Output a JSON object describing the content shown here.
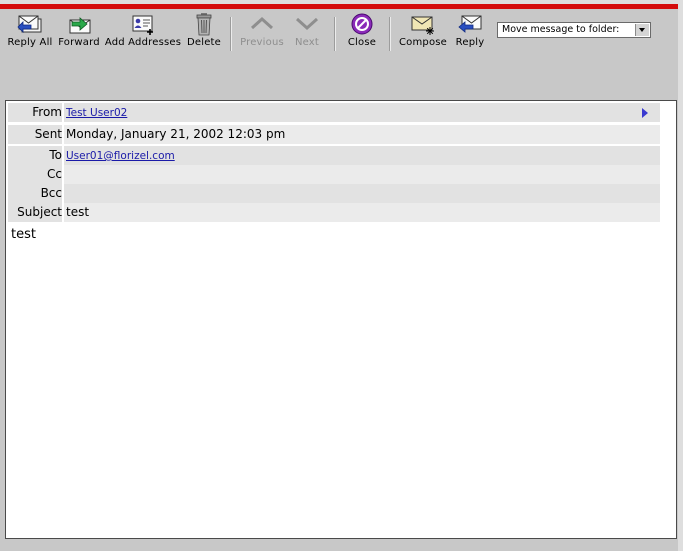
{
  "toolbar": {
    "reply_all": "Reply All",
    "forward": "Forward",
    "add_addresses": "Add Addresses",
    "delete": "Delete",
    "previous": "Previous",
    "next": "Next",
    "close": "Close",
    "compose": "Compose",
    "reply": "Reply",
    "move_folder": "Move message to folder:"
  },
  "message": {
    "from_label": "From",
    "from_value": "Test User02",
    "sent_label": "Sent",
    "sent_value": "Monday, January 21, 2002 12:03 pm",
    "to_label": "To",
    "to_value": "User01@florizel.com",
    "cc_label": "Cc",
    "cc_value": "",
    "bcc_label": "Bcc",
    "bcc_value": "",
    "subject_label": "Subject",
    "subject_value": "test",
    "body": "test"
  },
  "colors": {
    "accent": "#d40c0c",
    "link": "#1a1aa8",
    "toolbar_bg": "#c8c8c8"
  }
}
